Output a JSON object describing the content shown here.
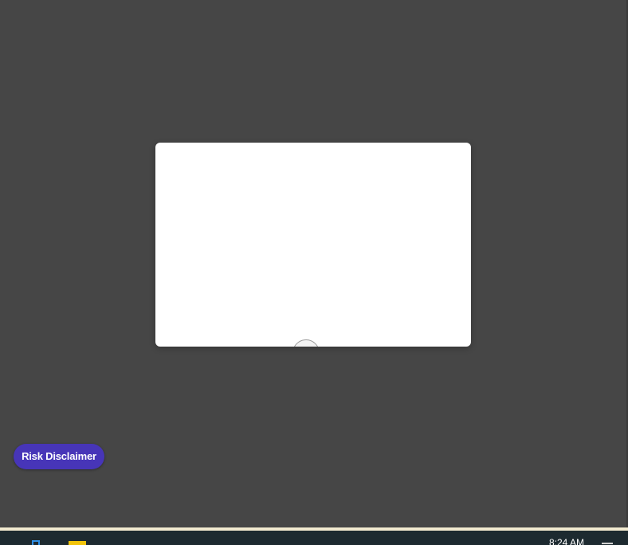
{
  "risk_disclaimer": {
    "label": "Risk Disclaimer"
  },
  "taskbar": {
    "clock_time": "8:24 AM",
    "icons": [
      "windows-start-icon",
      "file-explorer-icon",
      "notification-icon"
    ]
  },
  "colors": {
    "background": "#464646",
    "modal": "#ffffff",
    "button": "#4735b8",
    "taskbar": "#1d2a30",
    "taskbar_border": "#f2ead0"
  }
}
